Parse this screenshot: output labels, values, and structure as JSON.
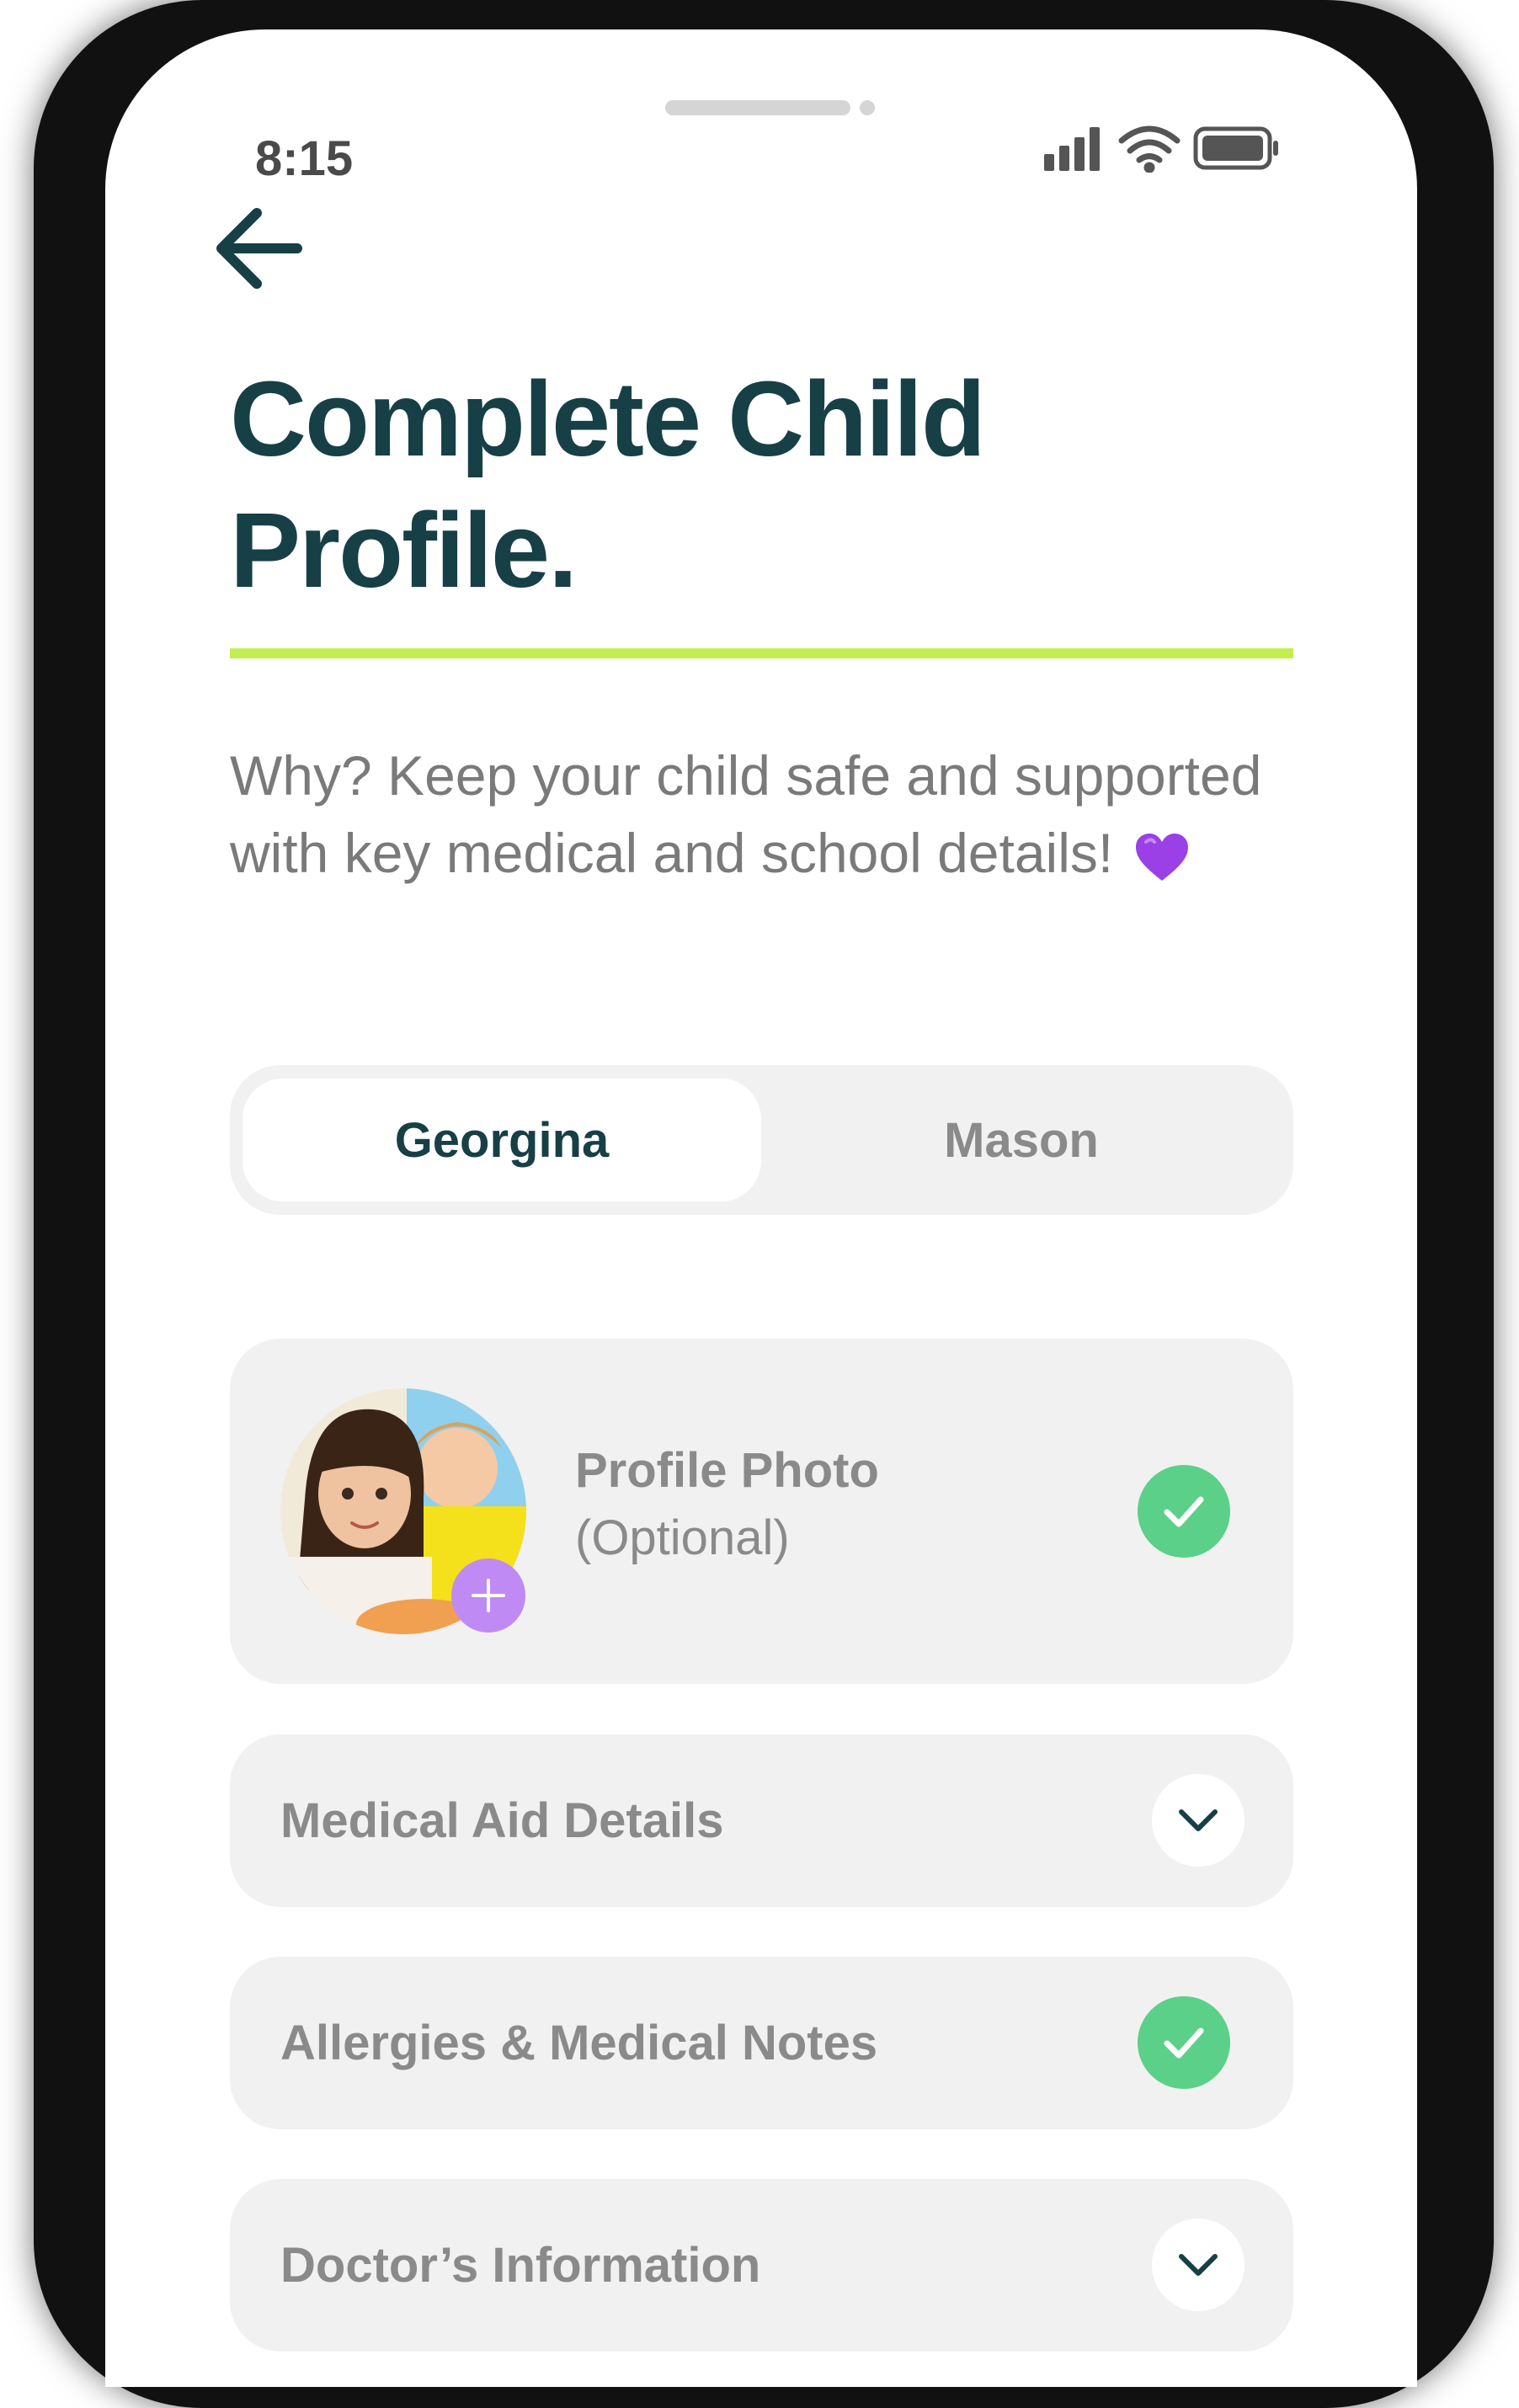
{
  "status_bar": {
    "time": "8:15",
    "icons": [
      "signal-icon",
      "wifi-icon",
      "battery-icon"
    ]
  },
  "header": {
    "back_icon": "arrow-left-icon",
    "title_line1": "Complete Child",
    "title_line2": "Profile.",
    "subtitle": "Why? Keep your child safe and supported with key medical and school details!",
    "subtitle_emoji": "purple-heart-icon"
  },
  "tabs": [
    {
      "label": "Georgina",
      "selected": true
    },
    {
      "label": "Mason",
      "selected": false
    }
  ],
  "sections": {
    "profile_photo": {
      "label": "Profile Photo",
      "sublabel": "(Optional)",
      "status": "complete",
      "add_icon": "plus-icon"
    },
    "items": [
      {
        "label": "Medical Aid Details",
        "status": "collapsed",
        "icon": "chevron-down-icon"
      },
      {
        "label": "Allergies & Medical Notes",
        "status": "complete",
        "icon": "check-icon"
      },
      {
        "label": "Doctor’s Information",
        "status": "collapsed",
        "icon": "chevron-down-icon"
      }
    ]
  },
  "colors": {
    "title": "#173f46",
    "accent_underline": "#c2ee4f",
    "check_green": "#5bd088",
    "add_purple": "#c08af4",
    "card_bg": "#f1f1f1",
    "muted_text": "#8a8a8a"
  }
}
